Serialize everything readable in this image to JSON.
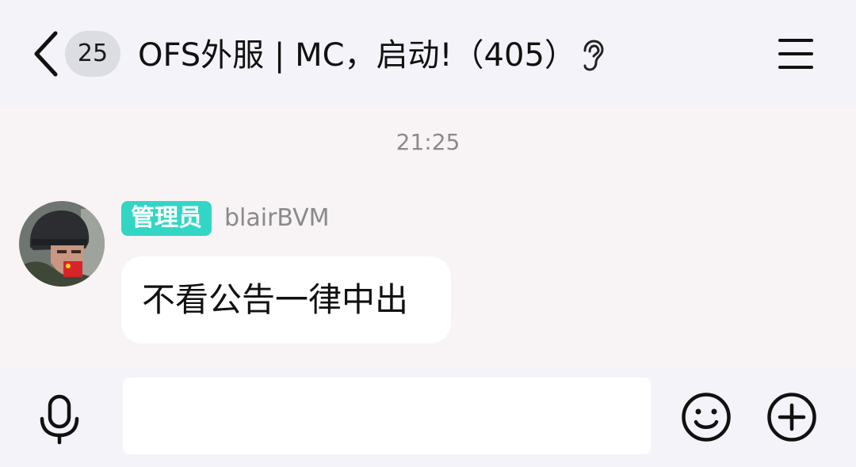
{
  "header": {
    "unread_count": "25",
    "title": "OFS外服 | MC，启动!（405）",
    "back_icon": "chevron-left-icon",
    "ear_icon": "ear-icon",
    "menu_icon": "hamburger-menu-icon"
  },
  "messages": [
    {
      "time": "21:25",
      "role": "管理员",
      "sender": "blairBVM",
      "text": "不看公告一律中出"
    }
  ],
  "input_bar": {
    "value": "",
    "mic_icon": "microphone-icon",
    "emoji_icon": "smiley-icon",
    "plus_icon": "plus-circle-icon"
  },
  "colors": {
    "header_bg": "#f3f3f9",
    "chat_bg": "#f8f3f5",
    "role_badge": "#33d6c4",
    "bubble": "#ffffff",
    "secondary_text": "#8a8a8a"
  }
}
